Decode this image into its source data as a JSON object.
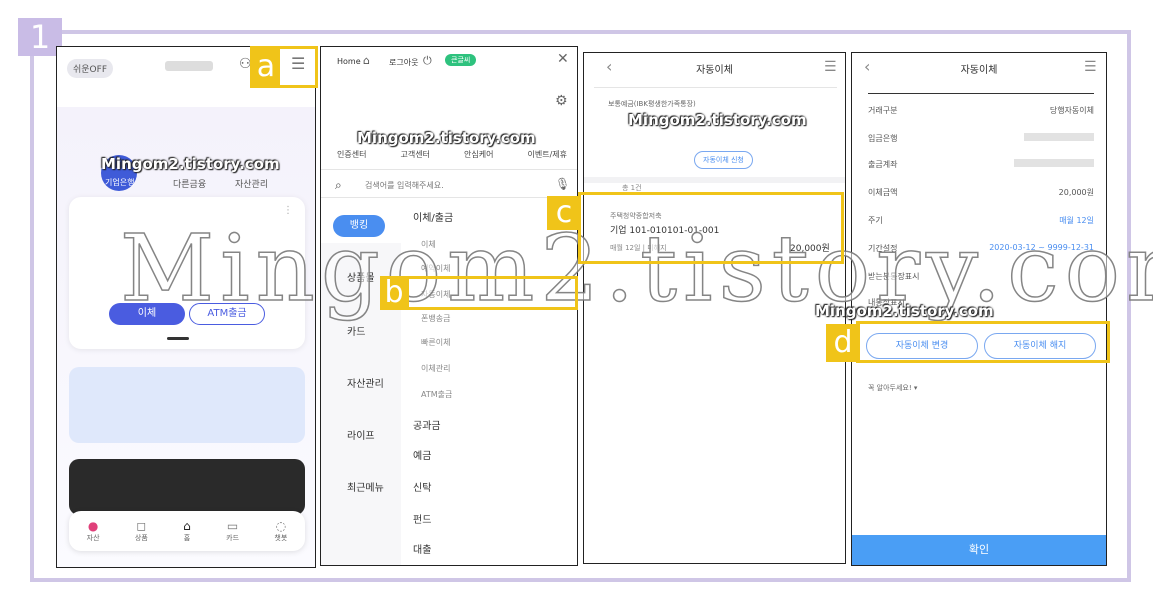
{
  "step_number": "1",
  "watermark": "Mingom2.tistory.com",
  "big_watermark": "Mingom2.tistory.com",
  "tags": {
    "a": "a",
    "b": "b",
    "c": "c",
    "d": "d"
  },
  "colors": {
    "frame": "#cfc6e6",
    "highlight": "#f0c419",
    "primary": "#4a5ce0",
    "accent": "#4a8ef0"
  },
  "screen1": {
    "easy_toggle": "쉬운OFF",
    "tabs": [
      "기업은행",
      "다른금융",
      "자산관리"
    ],
    "transfer_button": "이체",
    "atm_button": "ATM출금",
    "bottom_nav": [
      {
        "icon": "asset-icon",
        "label": "자산"
      },
      {
        "icon": "product-icon",
        "label": "상품"
      },
      {
        "icon": "home-icon",
        "label": "홈"
      },
      {
        "icon": "card-icon",
        "label": "카드"
      },
      {
        "icon": "chat-icon",
        "label": "챗봇"
      }
    ]
  },
  "screen2": {
    "home": "Home",
    "logout": "로그아웃",
    "badge": "큰글씨",
    "quick_links": [
      "인증센터",
      "고객센터",
      "안심케어",
      "이벤트/제휴"
    ],
    "search_placeholder": "검색어를 입력해주세요.",
    "left_menu": [
      "뱅킹",
      "상품몰",
      "카드",
      "자산관리",
      "라이프",
      "최근메뉴"
    ],
    "section_title": "이체/출금",
    "sub_items": [
      "이체",
      "예약이체",
      "자동이체",
      "폰뱅송금",
      "빠른이체",
      "이체관리",
      "ATM출금"
    ],
    "right_menu": [
      "공과금",
      "예금",
      "신탁",
      "펀드",
      "대출"
    ]
  },
  "screen3": {
    "title": "자동이체",
    "account_label": "보통예금(IBK평생한가족통장)",
    "register_button": "자동이체 신청",
    "count": "총 1건",
    "item_name": "주택청약종합저축",
    "item_account": "기업 101-010101-01-001",
    "item_date": "매월 12일 | 미해지",
    "item_amount": "20,000원"
  },
  "screen4": {
    "title": "자동이체",
    "rows": [
      {
        "label": "거래구분",
        "value": "당행자동이체"
      },
      {
        "label": "입금은행",
        "value": ""
      },
      {
        "label": "출금계좌",
        "value": ""
      },
      {
        "label": "이체금액",
        "value": "20,000원"
      },
      {
        "label": "주기",
        "value": "매월 12일"
      },
      {
        "label": "기간설정",
        "value": "2020-03-12 ~ 9999-12-31"
      },
      {
        "label": "받는분통장표시",
        "value": ""
      },
      {
        "label": "내통장표시",
        "value": ""
      }
    ],
    "change_button": "자동이체 변경",
    "cancel_button": "자동이체 해지",
    "notice": "꼭 알아두세요!",
    "confirm_button": "확인"
  }
}
